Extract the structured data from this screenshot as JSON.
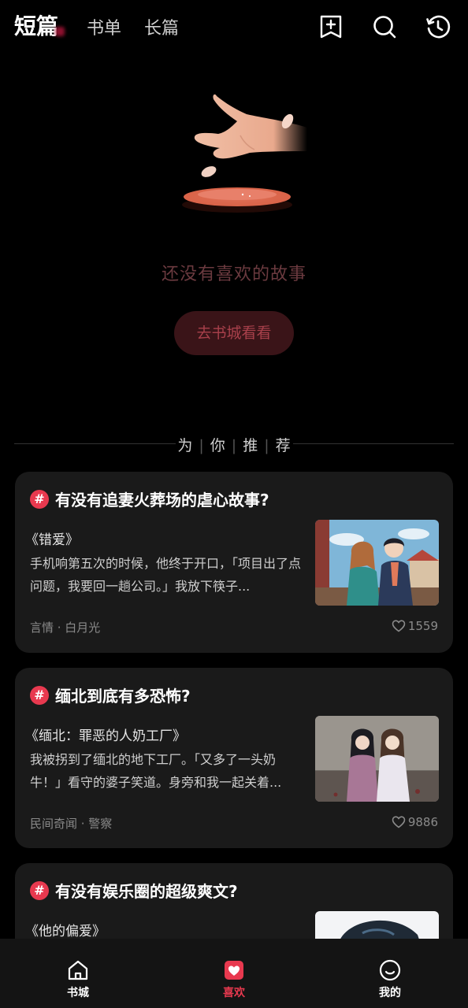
{
  "topbar": {
    "tabs": [
      {
        "label": "短篇",
        "active": true
      },
      {
        "label": "书单",
        "active": false
      },
      {
        "label": "长篇",
        "active": false
      }
    ],
    "icons": [
      "add-bookmark-icon",
      "search-icon",
      "history-icon"
    ]
  },
  "empty_state": {
    "message": "还没有喜欢的故事",
    "button_label": "去书城看看"
  },
  "recommend": {
    "chars": [
      "为",
      "你",
      "推",
      "荐"
    ]
  },
  "cards": [
    {
      "hash": "#",
      "question": "有没有追妻火葬场的虐心故事?",
      "book_title": "《错爱》",
      "excerpt": "手机响第五次的时候，他终于开口，「项目出了点问题，我要回一趟公司。」我放下筷子...",
      "tags": "言情 · 白月光",
      "likes": "1559"
    },
    {
      "hash": "#",
      "question": "缅北到底有多恐怖?",
      "book_title": "《缅北：罪恶的人奶工厂》",
      "excerpt": "我被拐到了缅北的地下工厂。「又多了一头奶牛！」看守的婆子笑道。身旁和我一起关着...",
      "tags": "民间奇闻 · 警察",
      "likes": "9886"
    },
    {
      "hash": "#",
      "question": "有没有娱乐圈的超级爽文?",
      "book_title": "《他的偏爱》",
      "excerpt": "",
      "tags": "",
      "likes": ""
    }
  ],
  "bottom_nav": [
    {
      "label": "书城",
      "icon": "home-icon",
      "active": false
    },
    {
      "label": "喜欢",
      "icon": "heart-icon",
      "active": true
    },
    {
      "label": "我的",
      "icon": "smile-icon",
      "active": false
    }
  ],
  "colors": {
    "background": "#000000",
    "card": "#1a1a1a",
    "accent": "#e8394f",
    "muted_text": "#8a8a8a"
  }
}
